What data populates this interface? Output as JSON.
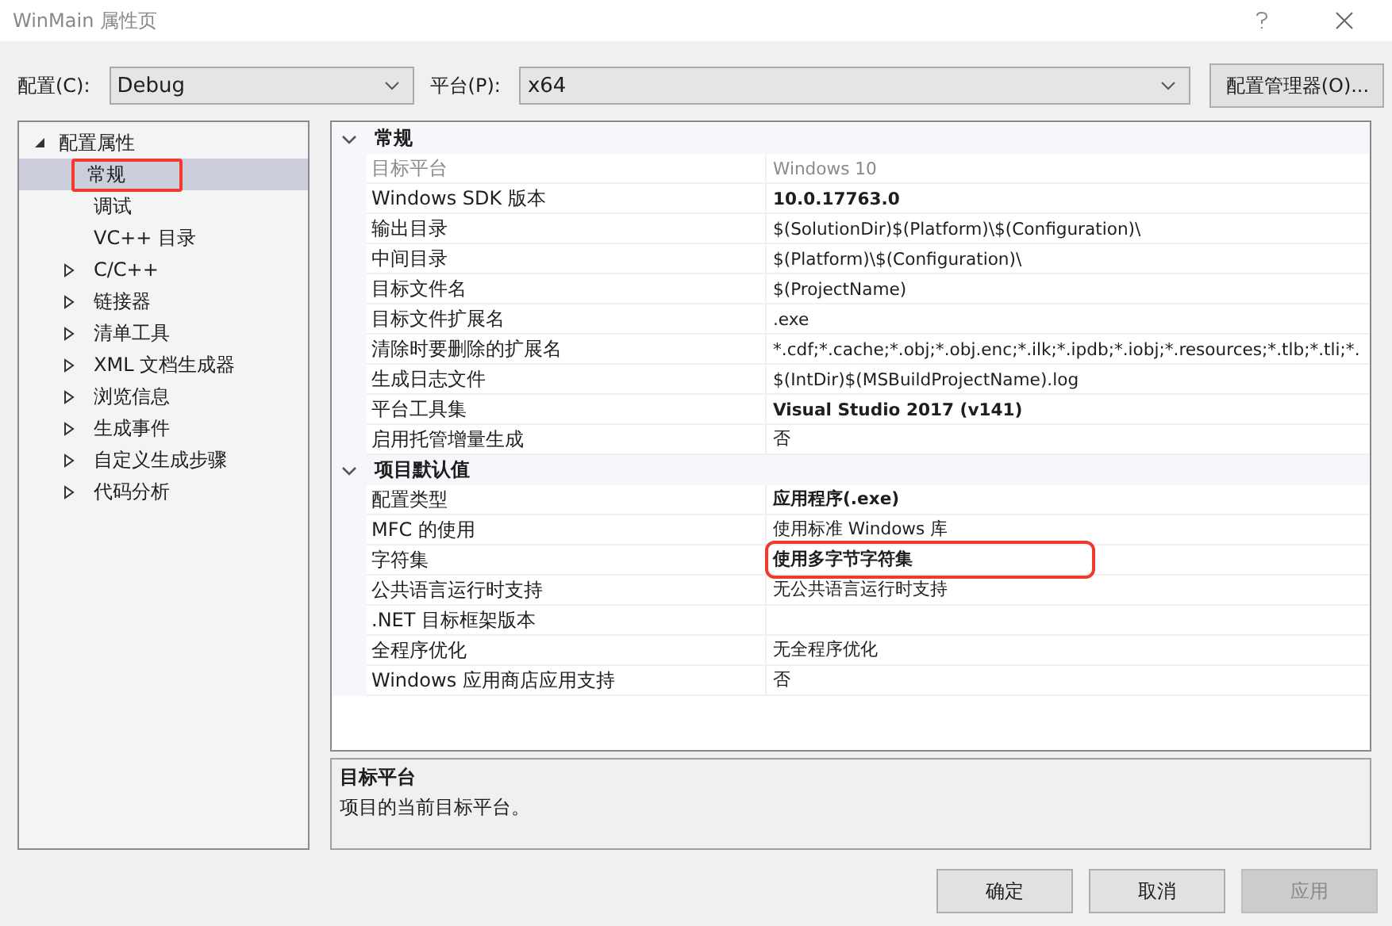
{
  "window": {
    "title": "WinMain 属性页"
  },
  "config_bar": {
    "config_label": "配置(C):",
    "config_value": "Debug",
    "platform_label": "平台(P):",
    "platform_value": "x64",
    "manager_button": "配置管理器(O)..."
  },
  "tree": [
    {
      "label": "配置属性",
      "expanded": true,
      "children": [
        {
          "label": "常规",
          "kind": "leaf",
          "selected": true,
          "highlighted": true
        },
        {
          "label": "调试",
          "kind": "leaf",
          "selected": false,
          "highlighted": false
        },
        {
          "label": "VC++ 目录",
          "kind": "leaf",
          "selected": false,
          "highlighted": false
        },
        {
          "label": "C/C++",
          "kind": "group",
          "selected": false,
          "highlighted": false
        },
        {
          "label": "链接器",
          "kind": "group",
          "selected": false,
          "highlighted": false
        },
        {
          "label": "清单工具",
          "kind": "group",
          "selected": false,
          "highlighted": false
        },
        {
          "label": "XML 文档生成器",
          "kind": "group",
          "selected": false,
          "highlighted": false
        },
        {
          "label": "浏览信息",
          "kind": "group",
          "selected": false,
          "highlighted": false
        },
        {
          "label": "生成事件",
          "kind": "group",
          "selected": false,
          "highlighted": false
        },
        {
          "label": "自定义生成步骤",
          "kind": "group",
          "selected": false,
          "highlighted": false
        },
        {
          "label": "代码分析",
          "kind": "group",
          "selected": false,
          "highlighted": false
        }
      ]
    }
  ],
  "grid": [
    {
      "title": "常规",
      "expanded": true,
      "rows": [
        {
          "name": "目标平台",
          "value": "Windows 10",
          "bold": false,
          "disabled": true,
          "highlighted": false
        },
        {
          "name": "Windows SDK 版本",
          "value": "10.0.17763.0",
          "bold": true,
          "disabled": false,
          "highlighted": false
        },
        {
          "name": "输出目录",
          "value": "$(SolutionDir)$(Platform)\\$(Configuration)\\",
          "bold": false,
          "disabled": false,
          "highlighted": false
        },
        {
          "name": "中间目录",
          "value": "$(Platform)\\$(Configuration)\\",
          "bold": false,
          "disabled": false,
          "highlighted": false
        },
        {
          "name": "目标文件名",
          "value": "$(ProjectName)",
          "bold": false,
          "disabled": false,
          "highlighted": false
        },
        {
          "name": "目标文件扩展名",
          "value": ".exe",
          "bold": false,
          "disabled": false,
          "highlighted": false
        },
        {
          "name": "清除时要删除的扩展名",
          "value": "*.cdf;*.cache;*.obj;*.obj.enc;*.ilk;*.ipdb;*.iobj;*.resources;*.tlb;*.tli;*.",
          "bold": false,
          "disabled": false,
          "highlighted": false
        },
        {
          "name": "生成日志文件",
          "value": "$(IntDir)$(MSBuildProjectName).log",
          "bold": false,
          "disabled": false,
          "highlighted": false
        },
        {
          "name": "平台工具集",
          "value": "Visual Studio 2017 (v141)",
          "bold": true,
          "disabled": false,
          "highlighted": false
        },
        {
          "name": "启用托管增量生成",
          "value": "否",
          "bold": false,
          "disabled": false,
          "highlighted": false
        }
      ]
    },
    {
      "title": "项目默认值",
      "expanded": true,
      "rows": [
        {
          "name": "配置类型",
          "value": "应用程序(.exe)",
          "bold": true,
          "disabled": false,
          "highlighted": false
        },
        {
          "name": "MFC 的使用",
          "value": "使用标准 Windows 库",
          "bold": false,
          "disabled": false,
          "highlighted": false
        },
        {
          "name": "字符集",
          "value": "使用多字节字符集",
          "bold": true,
          "disabled": false,
          "highlighted": true
        },
        {
          "name": "公共语言运行时支持",
          "value": "无公共语言运行时支持",
          "bold": false,
          "disabled": false,
          "highlighted": false
        },
        {
          "name": ".NET 目标框架版本",
          "bold": false,
          "disabled": false,
          "highlighted": false
        },
        {
          "name": "全程序优化",
          "value": "无全程序优化",
          "bold": false,
          "disabled": false,
          "highlighted": false
        },
        {
          "name": "Windows 应用商店应用支持",
          "value": "否",
          "bold": false,
          "disabled": false,
          "highlighted": false
        }
      ]
    }
  ],
  "description": {
    "title": "目标平台",
    "text": "项目的当前目标平台。"
  },
  "buttons": [
    {
      "label": "确定",
      "disabled": false
    },
    {
      "label": "取消",
      "disabled": false
    },
    {
      "label": "应用",
      "disabled": true
    }
  ]
}
